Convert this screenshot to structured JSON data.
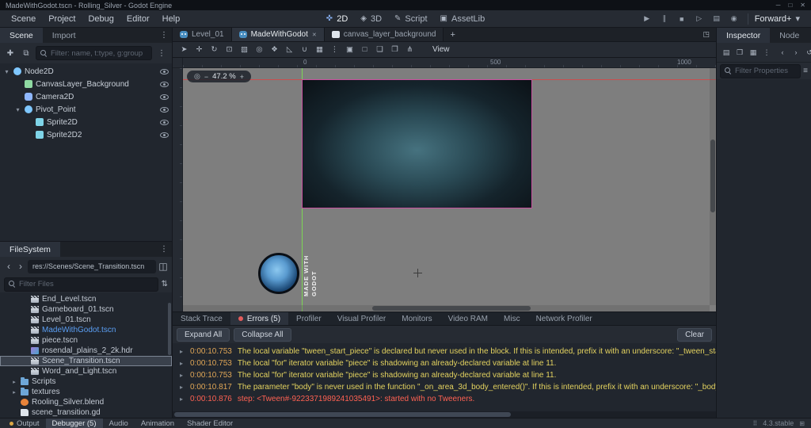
{
  "window": {
    "title": "MadeWithGodot.tscn - Rolling_Silver - Godot Engine"
  },
  "menubar": {
    "menus": [
      "Scene",
      "Project",
      "Debug",
      "Editor",
      "Help"
    ],
    "workspaces": [
      {
        "label": "2D",
        "icon": "workspace-2d-icon",
        "active": true
      },
      {
        "label": "3D",
        "icon": "workspace-3d-icon",
        "active": false
      },
      {
        "label": "Script",
        "icon": "workspace-script-icon",
        "active": false
      },
      {
        "label": "AssetLib",
        "icon": "workspace-assetlib-icon",
        "active": false
      }
    ],
    "playbar": [
      "play-icon",
      "pause-icon",
      "stop-icon",
      "play-scene-icon",
      "play-custom-scene-icon",
      "movie-maker-icon"
    ],
    "renderer": "Forward+"
  },
  "scene_dock": {
    "tabs": [
      {
        "label": "Scene",
        "active": true
      },
      {
        "label": "Import",
        "active": false
      }
    ],
    "filter_placeholder": "Filter: name, t:type, g:group",
    "tree": [
      {
        "label": "Node2D",
        "depth": 0,
        "arrow": "▾",
        "icon": "node2d",
        "extra": "tool"
      },
      {
        "label": "CanvasLayer_Background",
        "depth": 1,
        "arrow": "",
        "icon": "canvaslayer",
        "extra": "film"
      },
      {
        "label": "Camera2D",
        "depth": 1,
        "arrow": "",
        "icon": "camera",
        "extra": "none"
      },
      {
        "label": "Pivot_Point",
        "depth": 1,
        "arrow": "▾",
        "icon": "node2d",
        "extra": "none"
      },
      {
        "label": "Sprite2D",
        "depth": 2,
        "arrow": "",
        "icon": "sprite",
        "extra": "none"
      },
      {
        "label": "Sprite2D2",
        "depth": 2,
        "arrow": "",
        "icon": "sprite",
        "extra": "none"
      }
    ]
  },
  "filesystem": {
    "title": "FileSystem",
    "path": "res://Scenes/Scene_Transition.tscn",
    "filter_placeholder": "Filter Files",
    "files": [
      {
        "label": "End_Level.tscn",
        "type": "scene",
        "depth": 2,
        "state": "normal",
        "arrow": ""
      },
      {
        "label": "Gameboard_01.tscn",
        "type": "scene",
        "depth": 2,
        "state": "normal",
        "arrow": ""
      },
      {
        "label": "Level_01.tscn",
        "type": "scene",
        "depth": 2,
        "state": "normal",
        "arrow": ""
      },
      {
        "label": "MadeWithGodot.tscn",
        "type": "scene",
        "depth": 2,
        "state": "open",
        "arrow": ""
      },
      {
        "label": "piece.tscn",
        "type": "scene",
        "depth": 2,
        "state": "normal",
        "arrow": ""
      },
      {
        "label": "rosendal_plains_2_2k.hdr",
        "type": "image",
        "depth": 2,
        "state": "normal",
        "arrow": ""
      },
      {
        "label": "Scene_Transition.tscn",
        "type": "scene",
        "depth": 2,
        "state": "selected",
        "arrow": ""
      },
      {
        "label": "Word_and_Light.tscn",
        "type": "scene",
        "depth": 2,
        "state": "normal",
        "arrow": ""
      },
      {
        "label": "Scripts",
        "type": "folder",
        "depth": 1,
        "state": "normal",
        "arrow": "▸"
      },
      {
        "label": "textures",
        "type": "folder",
        "depth": 1,
        "state": "normal",
        "arrow": "▸"
      },
      {
        "label": "Rooling_Silver.blend",
        "type": "blend",
        "depth": 1,
        "state": "normal",
        "arrow": ""
      },
      {
        "label": "scene_transition.gd",
        "type": "script",
        "depth": 1,
        "state": "normal",
        "arrow": ""
      }
    ]
  },
  "main": {
    "scene_tabs": [
      {
        "label": "Level_01",
        "active": false,
        "closable": false,
        "icon": "godot"
      },
      {
        "label": "MadeWithGodot",
        "active": true,
        "closable": true,
        "icon": "godot"
      },
      {
        "label": "canvas_layer_background",
        "active": false,
        "closable": false,
        "icon": "node"
      }
    ],
    "tools": [
      "select-tool-icon",
      "move-tool-icon",
      "rotate-tool-icon",
      "scale-tool-icon",
      "select-region-icon",
      "pivot-tool-icon",
      "pan-tool-icon",
      "ruler-tool-icon",
      "smart-snap-icon",
      "grid-snap-icon",
      "snap-options-icon",
      "lock-object-icon",
      "unlock-object-icon",
      "group-object-icon",
      "ungroup-object-icon",
      "skeleton-options-icon"
    ],
    "view_menu": "View",
    "zoom": "47.2 %",
    "ruler_labels": [
      "0",
      "500",
      "1000"
    ],
    "logo_caption": "MADE WITH GODOT"
  },
  "debugger": {
    "tabs": [
      {
        "label": "Stack Trace",
        "active": false,
        "dot": false
      },
      {
        "label": "Errors (5)",
        "active": true,
        "dot": true
      },
      {
        "label": "Profiler",
        "active": false,
        "dot": false
      },
      {
        "label": "Visual Profiler",
        "active": false,
        "dot": false
      },
      {
        "label": "Monitors",
        "active": false,
        "dot": false
      },
      {
        "label": "Video RAM",
        "active": false,
        "dot": false
      },
      {
        "label": "Misc",
        "active": false,
        "dot": false
      },
      {
        "label": "Network Profiler",
        "active": false,
        "dot": false
      }
    ],
    "expand_all": "Expand All",
    "collapse_all": "Collapse All",
    "clear": "Clear",
    "errors": [
      {
        "time": "0:00:10.753",
        "message": "The local variable \"tween_start_piece\" is declared but never used in the block. If this is intended, prefix it with an underscore: \"_tween_start_piece\".",
        "level": "warning"
      },
      {
        "time": "0:00:10.753",
        "message": "The local \"for\" iterator variable \"piece\" is shadowing an already-declared variable at line 11.",
        "level": "warning"
      },
      {
        "time": "0:00:10.753",
        "message": "The local \"for\" iterator variable \"piece\" is shadowing an already-declared variable at line 11.",
        "level": "warning"
      },
      {
        "time": "0:00:10.817",
        "message": "The parameter \"body\" is never used in the function \"_on_area_3d_body_entered()\". If this is intended, prefix it with an underscore: \"_body\".",
        "level": "warning"
      },
      {
        "time": "0:00:10.876",
        "message": "step: <Tween#-9223371989241035491>: started with no Tweeners.",
        "level": "error"
      }
    ]
  },
  "inspector": {
    "tabs": [
      {
        "label": "Inspector",
        "active": true
      },
      {
        "label": "Node",
        "active": false
      }
    ],
    "toolbar_left": [
      "new-resource-icon",
      "load-resource-icon",
      "save-resource-icon",
      "resource-menu-icon"
    ],
    "toolbar_right": [
      "history-back-icon",
      "history-forward-icon",
      "object-history-icon"
    ],
    "filter_placeholder": "Filter Properties"
  },
  "statusbar": {
    "items": [
      {
        "label": "Output",
        "dot": true,
        "active": false
      },
      {
        "label": "Debugger (5)",
        "dot": false,
        "active": true
      },
      {
        "label": "Audio",
        "dot": false,
        "active": false
      },
      {
        "label": "Animation",
        "dot": false,
        "active": false
      },
      {
        "label": "Shader Editor",
        "dot": false,
        "active": false
      }
    ],
    "version": "4.3.stable"
  },
  "colors": {
    "accent": "#699ce8",
    "warning_text": "#e3d25f",
    "error_text": "#ff6152",
    "timestamp_text": "#e0a656",
    "canvas_background": "#7e7e7e",
    "viewport_border": "#c9509e",
    "y_axis": "#7de04f",
    "x_axis": "#d64545"
  }
}
